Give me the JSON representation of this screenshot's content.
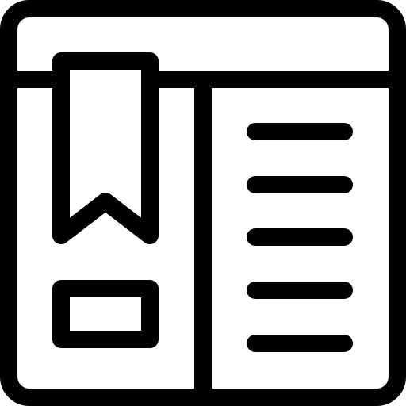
{
  "icon": {
    "name": "bookmark-page-icon",
    "stroke_color": "#000000",
    "fill_color": "#ffffff"
  }
}
